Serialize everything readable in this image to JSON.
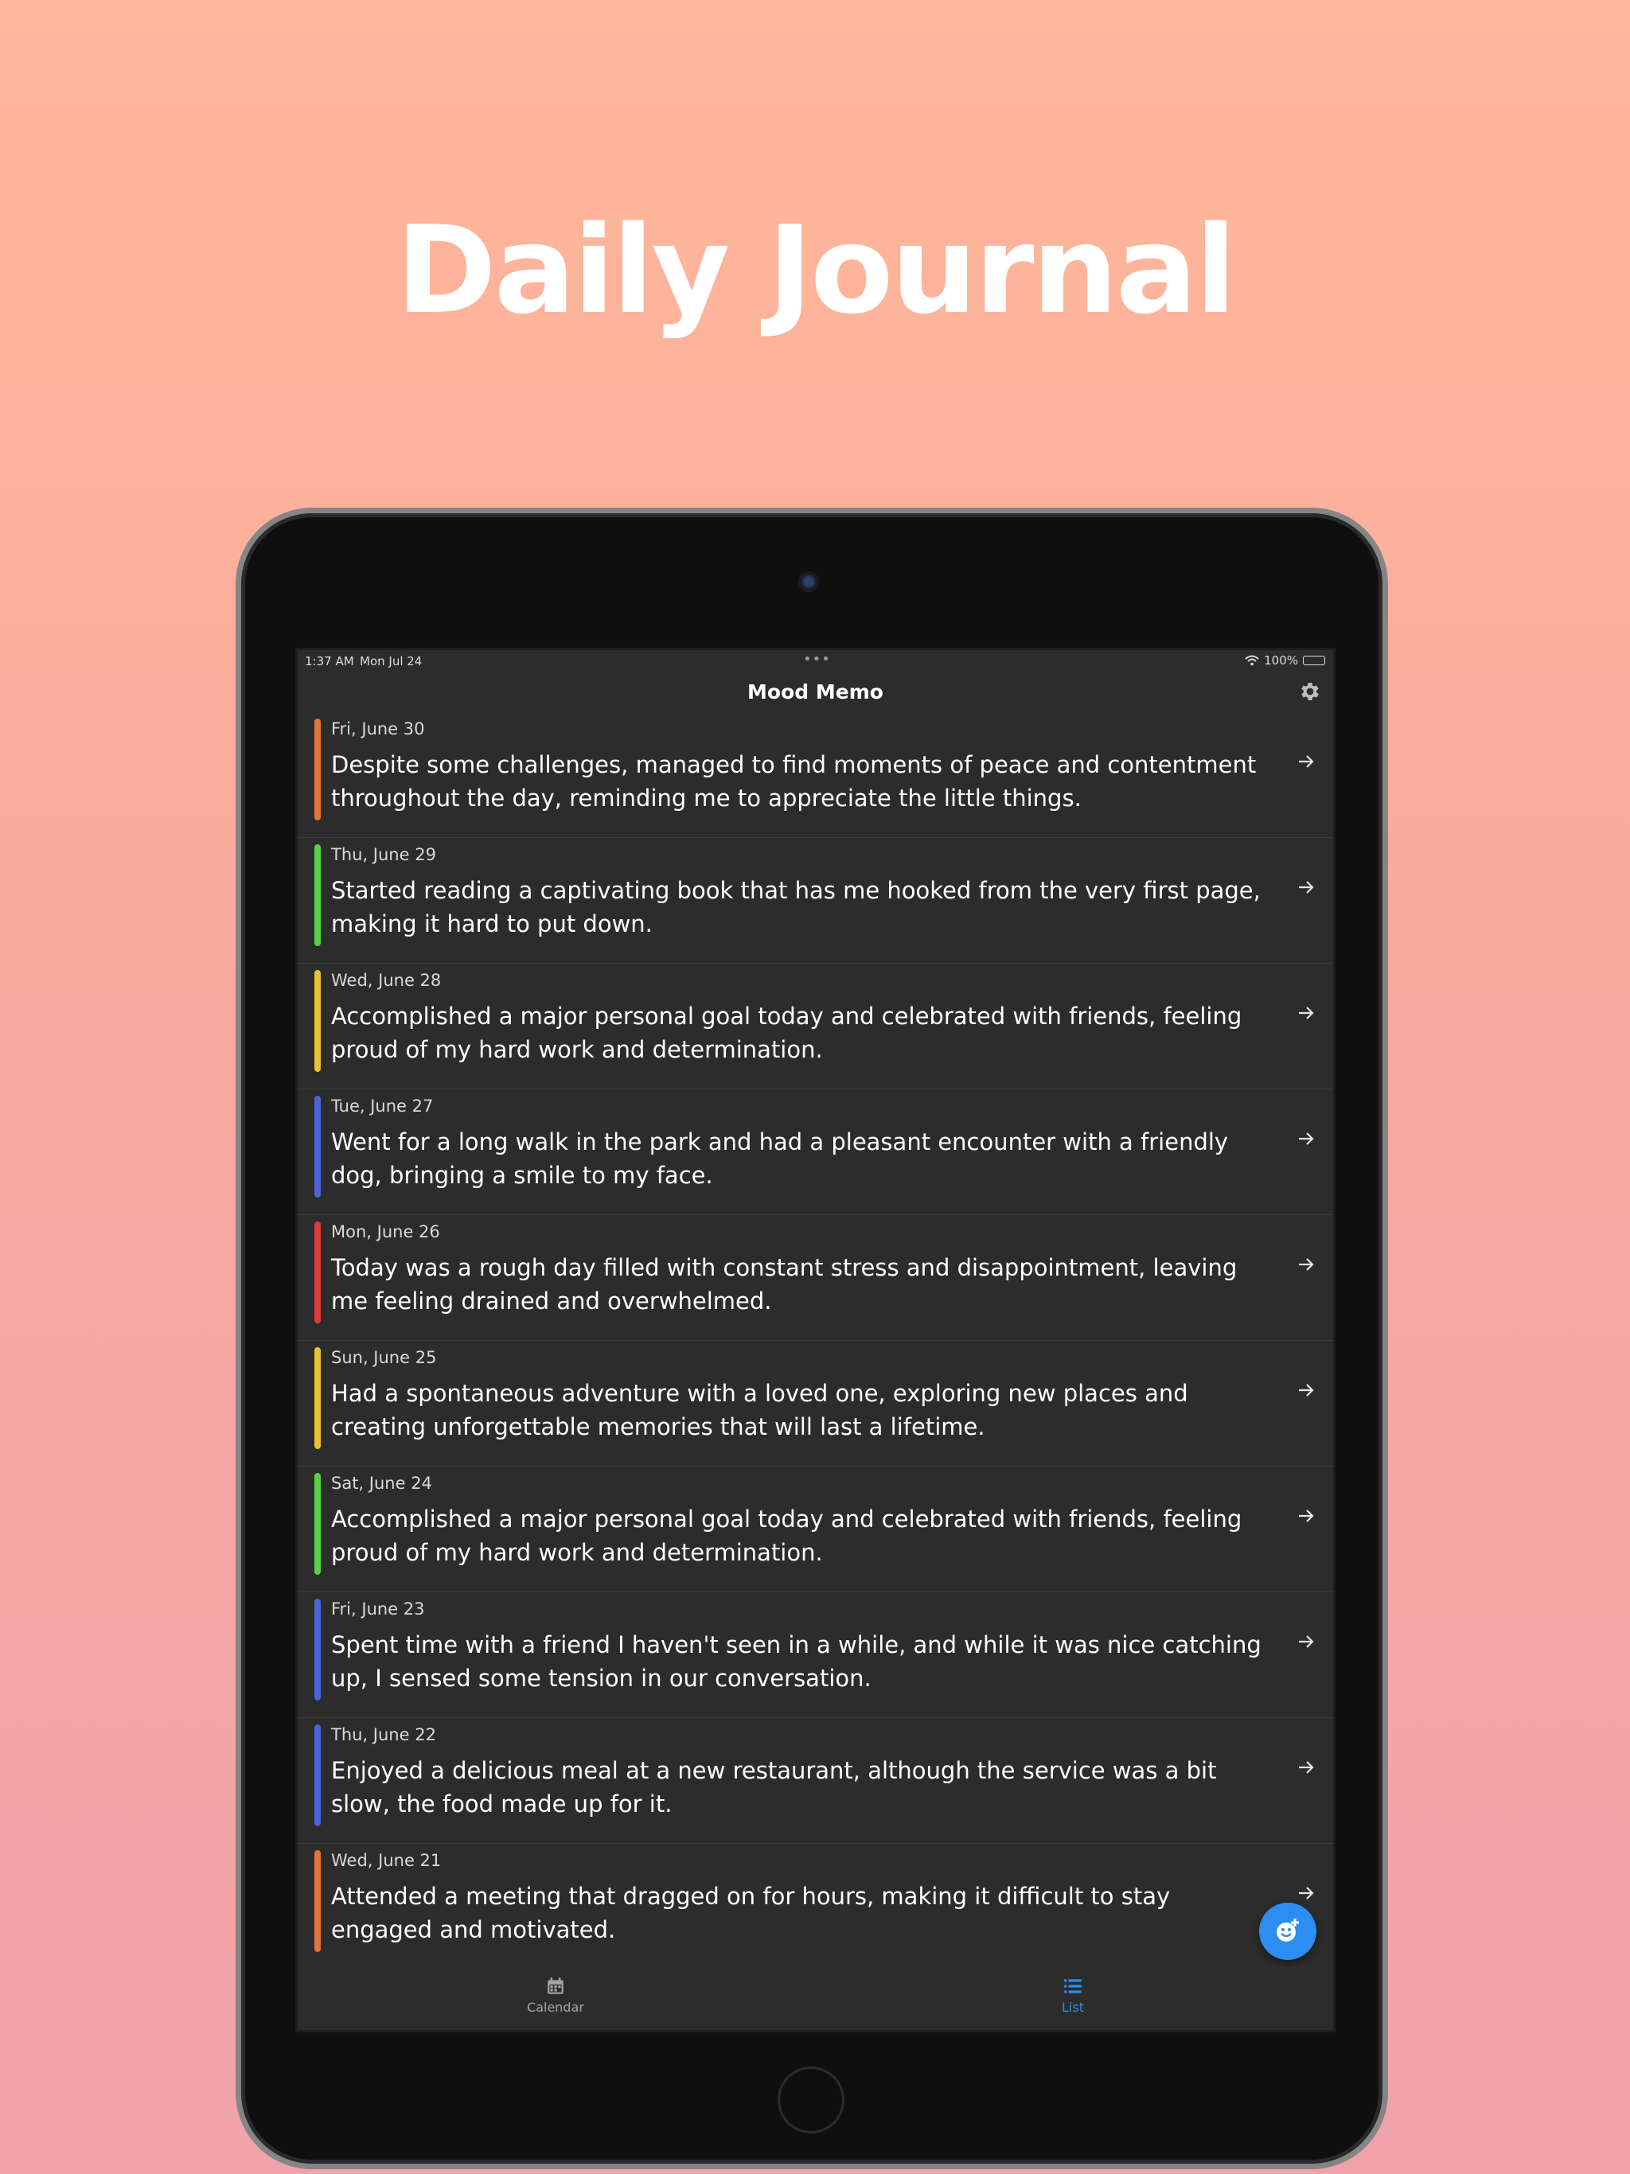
{
  "headline": "Daily Journal",
  "status_bar": {
    "time": "1:37 AM",
    "date": "Mon Jul 24",
    "dots": "•••",
    "battery": "100%",
    "battery_level": 1.0
  },
  "nav": {
    "title": "Mood Memo",
    "settings_icon": "gear-icon"
  },
  "entries": [
    {
      "date": "Fri, June 30",
      "text": "Despite some challenges, managed to find moments of peace and contentment throughout the day, reminding me to appreciate the little things.",
      "mood_color": "#e2743a"
    },
    {
      "date": "Thu, June 29",
      "text": "Started reading a captivating book that has me hooked from the very first page, making it hard to put down.",
      "mood_color": "#5ccf45"
    },
    {
      "date": "Wed, June 28",
      "text": "Accomplished a major personal goal today and celebrated with friends, feeling proud of my hard work and determination.",
      "mood_color": "#e6c232"
    },
    {
      "date": "Tue, June 27",
      "text": "Went for a long walk in the park and had a pleasant encounter with a friendly dog, bringing a smile to my face.",
      "mood_color": "#4b63d4"
    },
    {
      "date": "Mon, June 26",
      "text": "Today was a rough day filled with constant stress and disappointment, leaving me feeling drained and overwhelmed.",
      "mood_color": "#df3b3b"
    },
    {
      "date": "Sun, June 25",
      "text": "Had a spontaneous adventure with a loved one, exploring new places and creating unforgettable memories that will last a lifetime.",
      "mood_color": "#e6c232"
    },
    {
      "date": "Sat, June 24",
      "text": "Accomplished a major personal goal today and celebrated with friends, feeling proud of my hard work and determination.",
      "mood_color": "#5ccf45"
    },
    {
      "date": "Fri, June 23",
      "text": "Spent time with a friend I haven't seen in a while, and while it was nice catching up, I sensed some tension in our conversation.",
      "mood_color": "#4b63d4"
    },
    {
      "date": "Thu, June 22",
      "text": "Enjoyed a delicious meal at a new restaurant, although the service was a bit slow, the food made up for it.",
      "mood_color": "#4b63d4"
    },
    {
      "date": "Wed, June 21",
      "text": "Attended a meeting that dragged on for hours, making it difficult to stay engaged and motivated.",
      "mood_color": "#e2743a"
    }
  ],
  "fab": {
    "icon": "add-mood-icon",
    "color": "#2b8ef0"
  },
  "tabs": {
    "calendar": {
      "label": "Calendar",
      "icon": "calendar-icon"
    },
    "list": {
      "label": "List",
      "icon": "list-icon",
      "active": true
    }
  }
}
